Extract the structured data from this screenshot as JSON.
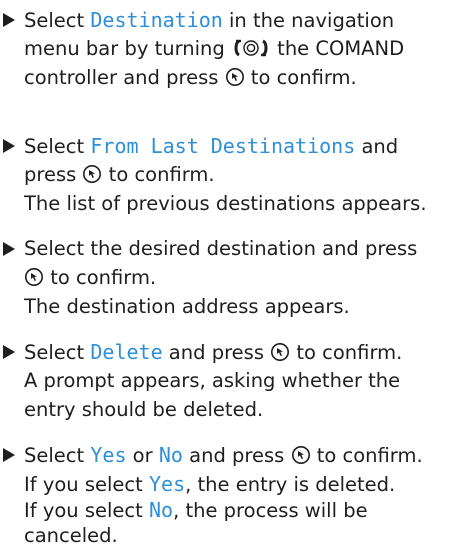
{
  "steps": [
    {
      "lines": [
        {
          "segments": [
            {
              "text": "Select "
            },
            {
              "text": "Destination",
              "hl": true
            },
            {
              "text": " in the navigation"
            }
          ]
        },
        {
          "segments": [
            {
              "text": "menu bar by turning "
            },
            {
              "icon": "rotate-controller-icon"
            },
            {
              "text": " the COMAND"
            }
          ]
        },
        {
          "segments": [
            {
              "text": "controller and press "
            },
            {
              "icon": "press-controller-icon"
            },
            {
              "text": " to confirm."
            }
          ]
        }
      ]
    },
    {
      "lines": [
        {
          "segments": [
            {
              "text": "Select "
            },
            {
              "text": "From Last Destinations",
              "hl": true
            },
            {
              "text": " and"
            }
          ]
        },
        {
          "segments": [
            {
              "text": "press "
            },
            {
              "icon": "press-controller-icon"
            },
            {
              "text": " to confirm."
            }
          ]
        },
        {
          "segments": [
            {
              "text": "The list of previous destinations appears."
            }
          ]
        }
      ]
    },
    {
      "lines": [
        {
          "segments": [
            {
              "text": "Select the desired destination and press"
            }
          ]
        },
        {
          "segments": [
            {
              "icon": "press-controller-icon"
            },
            {
              "text": " to confirm."
            }
          ]
        },
        {
          "segments": [
            {
              "text": "The destination address appears."
            }
          ]
        }
      ]
    },
    {
      "lines": [
        {
          "segments": [
            {
              "text": "Select "
            },
            {
              "text": "Delete",
              "hl": true
            },
            {
              "text": " and press "
            },
            {
              "icon": "press-controller-icon"
            },
            {
              "text": " to confirm."
            }
          ]
        },
        {
          "segments": [
            {
              "text": "A prompt appears, asking whether the"
            }
          ]
        },
        {
          "segments": [
            {
              "text": "entry should be deleted."
            }
          ]
        }
      ]
    },
    {
      "lines": [
        {
          "segments": [
            {
              "text": "Select "
            },
            {
              "text": "Yes",
              "hl": true
            },
            {
              "text": " or "
            },
            {
              "text": "No",
              "hl": true
            },
            {
              "text": " and press "
            },
            {
              "icon": "press-controller-icon"
            },
            {
              "text": " to confirm."
            }
          ]
        },
        {
          "segments": [
            {
              "text": "If you select "
            },
            {
              "text": "Yes",
              "hl": true
            },
            {
              "text": ", the entry is deleted."
            }
          ]
        },
        {
          "segments": [
            {
              "text": "If you select "
            },
            {
              "text": "No",
              "hl": true
            },
            {
              "text": ", the process will be"
            }
          ]
        },
        {
          "segments": [
            {
              "text": "canceled."
            }
          ]
        }
      ]
    }
  ],
  "colors": {
    "highlight": "#2d8fd8",
    "text": "#1e1e1e"
  }
}
